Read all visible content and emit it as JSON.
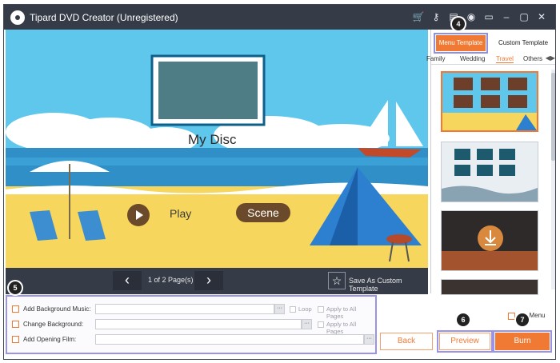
{
  "window": {
    "title": "Tipard DVD Creator (Unregistered)",
    "toolbar_icons": [
      "cart-icon",
      "key-icon",
      "register-icon",
      "user-icon",
      "feedback-icon",
      "minimize-icon",
      "maximize-icon",
      "close-icon"
    ]
  },
  "preview": {
    "disc_title": "My Disc",
    "play_label": "Play",
    "scene_label": "Scene"
  },
  "pager": {
    "prev": "‹",
    "next": "›",
    "page_text": "1 of 2 Page(s)",
    "save_template_label": "Save As Custom Template"
  },
  "side": {
    "tabs": {
      "menu": "Menu Template",
      "custom": "Custom Template"
    },
    "categories": [
      "Family",
      "Wedding",
      "Travel",
      "Others"
    ],
    "active_category": "Travel",
    "nav_arrows": "◀▶"
  },
  "options": {
    "bg_music_label": "Add Background Music:",
    "change_bg_label": "Change Background:",
    "opening_film_label": "Add Opening Film:",
    "loop_label": "Loop",
    "apply_all_label": "Apply to All Pages",
    "browse_label": "···"
  },
  "actions": {
    "no_menu_label": "No Menu",
    "back": "Back",
    "preview": "Preview",
    "burn": "Burn"
  },
  "badges": {
    "b4": "4",
    "b5": "5",
    "b6": "6",
    "b7": "7"
  },
  "colors": {
    "accent": "#f07a34",
    "highlight": "#9a94e6",
    "titlebar": "#353b47"
  }
}
